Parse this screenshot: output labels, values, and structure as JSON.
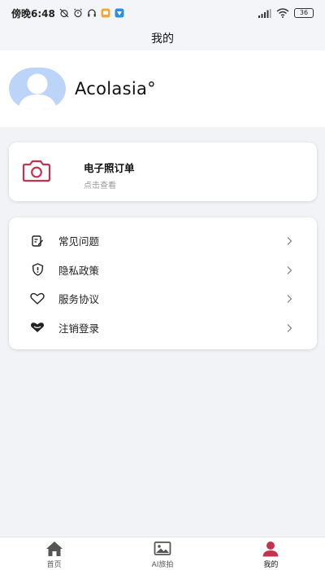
{
  "status_bar": {
    "time": "傍晚6:48",
    "battery": "36"
  },
  "header": {
    "title": "我的"
  },
  "profile": {
    "username": "Acolasia°"
  },
  "order_card": {
    "title": "电子照订单",
    "subtitle": "点击查看",
    "icon": "camera-icon",
    "accent": "#c4324e"
  },
  "menu": {
    "items": [
      {
        "label": "常见问题",
        "icon": "faq-edit-icon"
      },
      {
        "label": "隐私政策",
        "icon": "privacy-shield-icon"
      },
      {
        "label": "服务协议",
        "icon": "heart-icon"
      },
      {
        "label": "注销登录",
        "icon": "logout-icon"
      }
    ]
  },
  "tab_bar": {
    "tabs": [
      {
        "label": "首页",
        "icon": "home-icon"
      },
      {
        "label": "AI旅拍",
        "icon": "image-icon"
      },
      {
        "label": "我的",
        "icon": "user-icon",
        "active": true
      }
    ],
    "active_color": "#c4324e"
  }
}
